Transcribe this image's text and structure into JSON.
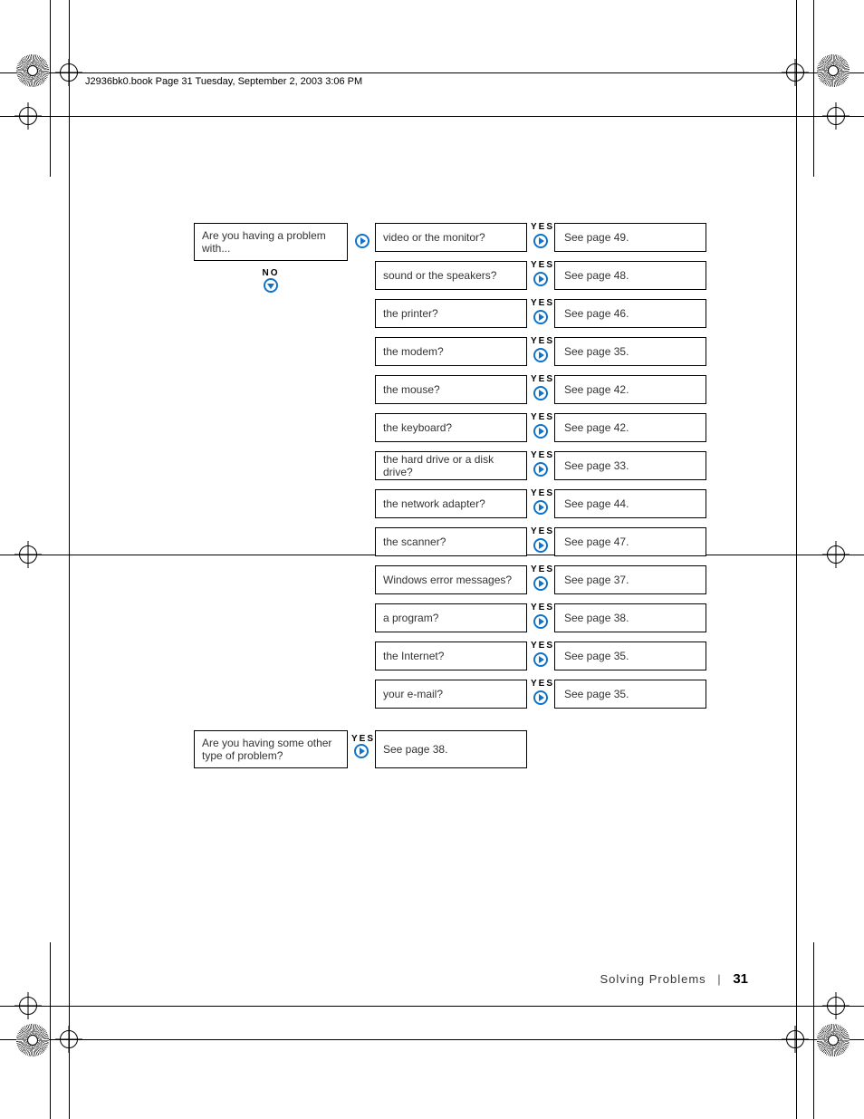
{
  "header": {
    "stamp": "J2936bk0.book  Page 31  Tuesday, September 2, 2003  3:06 PM"
  },
  "flow": {
    "question1": "Are you having a problem with...",
    "no_label": "NO",
    "yes_label": "YES",
    "items": [
      {
        "q": "video or the monitor?",
        "a": "See page 49."
      },
      {
        "q": "sound or the speakers?",
        "a": "See page 48."
      },
      {
        "q": "the printer?",
        "a": "See page 46."
      },
      {
        "q": "the modem?",
        "a": "See page 35."
      },
      {
        "q": "the mouse?",
        "a": "See page 42."
      },
      {
        "q": "the keyboard?",
        "a": "See page 42."
      },
      {
        "q": "the hard drive or a disk drive?",
        "a": "See page 33."
      },
      {
        "q": "the network adapter?",
        "a": "See page 44."
      },
      {
        "q": "the scanner?",
        "a": "See page 47."
      },
      {
        "q": "Windows error messages?",
        "a": "See page 37."
      },
      {
        "q": "a program?",
        "a": "See page 38."
      },
      {
        "q": "the Internet?",
        "a": "See page 35."
      },
      {
        "q": "your e-mail?",
        "a": "See page 35."
      }
    ],
    "question2": "Are you having some other type of problem?",
    "answer2": "See page 38."
  },
  "footer": {
    "section": "Solving Problems",
    "page": "31"
  }
}
